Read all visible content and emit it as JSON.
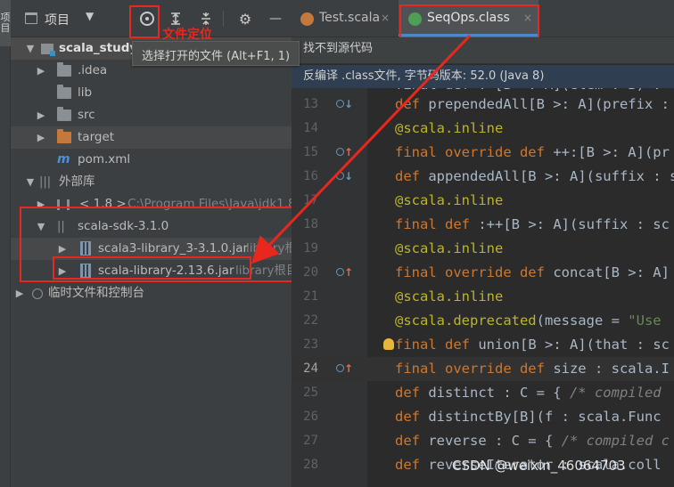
{
  "left_strip": {
    "tab_label": "项目"
  },
  "project_panel": {
    "title": "项目",
    "dropdown_glyph": "▼",
    "toolbar": {
      "locate_tooltip": "选择打开的文件 (Alt+F1, 1)",
      "locate_annotation": "文件定位",
      "gear_glyph": "⚙",
      "minimize_glyph": "—"
    },
    "tree": [
      {
        "name": "scala_study",
        "dim": ""
      },
      {
        "name": ".idea"
      },
      {
        "name": "lib"
      },
      {
        "name": "src"
      },
      {
        "name": "target"
      },
      {
        "name": "pom.xml"
      },
      {
        "name": "外部库"
      },
      {
        "name": "< 1.8 >",
        "dim": "C:\\Program Files\\Java\\jdk1.8"
      },
      {
        "name": "scala-sdk-3.1.0"
      },
      {
        "name": "scala3-library_3-3.1.0.jar",
        "dim": "library根"
      },
      {
        "name": "scala-library-2.13.6.jar",
        "dim": "library根目"
      },
      {
        "name": "临时文件和控制台"
      }
    ]
  },
  "editor": {
    "tabs": [
      {
        "label": "Test.scala",
        "close": "×"
      },
      {
        "label": "SeqOps.class",
        "close": "×"
      }
    ],
    "notice_source": "找不到源代码",
    "notice_decompiled": "反编译 .class文件, 字节码版本: 52.0 (Java 8)",
    "partial_line": "final def :+[B >: A](elem : B) :",
    "lines": [
      {
        "n": "13",
        "segs": [
          [
            "kw",
            "def "
          ],
          [
            "",
            "prependedAll[B >: A](prefix : "
          ]
        ]
      },
      {
        "n": "14",
        "segs": [
          [
            "ann",
            "@scala.inline"
          ]
        ]
      },
      {
        "n": "15",
        "segs": [
          [
            "kw",
            "final override def "
          ],
          [
            "",
            "++:[B >: A](pr"
          ]
        ]
      },
      {
        "n": "16",
        "segs": [
          [
            "kw",
            "def "
          ],
          [
            "",
            "appendedAll[B >: A](suffix : s"
          ]
        ]
      },
      {
        "n": "17",
        "segs": [
          [
            "ann",
            "@scala.inline"
          ]
        ]
      },
      {
        "n": "18",
        "segs": [
          [
            "kw",
            "final def "
          ],
          [
            "",
            ":++[B >: A](suffix : sc"
          ]
        ]
      },
      {
        "n": "19",
        "segs": [
          [
            "ann",
            "@scala.inline"
          ]
        ]
      },
      {
        "n": "20",
        "segs": [
          [
            "kw",
            "final override def "
          ],
          [
            "",
            "concat[B >: A]"
          ]
        ]
      },
      {
        "n": "21",
        "segs": [
          [
            "ann",
            "@scala.inline"
          ]
        ]
      },
      {
        "n": "22",
        "segs": [
          [
            "ann",
            "@scala.deprecated"
          ],
          [
            "",
            "(message = "
          ],
          [
            "st",
            "\"Use"
          ]
        ]
      },
      {
        "n": "23",
        "segs": [
          [
            "kw",
            "final def "
          ],
          [
            "",
            "union[B >: A](that : sc"
          ]
        ]
      },
      {
        "n": "24",
        "segs": [
          [
            "kw",
            "final override def "
          ],
          [
            "",
            "size : scala.I"
          ]
        ]
      },
      {
        "n": "25",
        "segs": [
          [
            "kw",
            "def "
          ],
          [
            "",
            "distinct : C = { "
          ],
          [
            "cm",
            "/* compiled"
          ]
        ]
      },
      {
        "n": "26",
        "segs": [
          [
            "kw",
            "def "
          ],
          [
            "",
            "distinctBy[B](f : scala.Func"
          ]
        ]
      },
      {
        "n": "27",
        "segs": [
          [
            "kw",
            "def "
          ],
          [
            "",
            "reverse : C = { "
          ],
          [
            "cm",
            "/* compiled c"
          ]
        ]
      },
      {
        "n": "28",
        "segs": [
          [
            "kw",
            "def "
          ],
          [
            "",
            "reverseIterator : scala.coll"
          ]
        ]
      }
    ]
  },
  "watermark": "CSDN @weixin_46064703",
  "colors": {
    "annotation_red": "#e8271e",
    "keyword": "#cc7832",
    "annotation": "#bbb529",
    "tab_accent": "#4a88c7"
  }
}
